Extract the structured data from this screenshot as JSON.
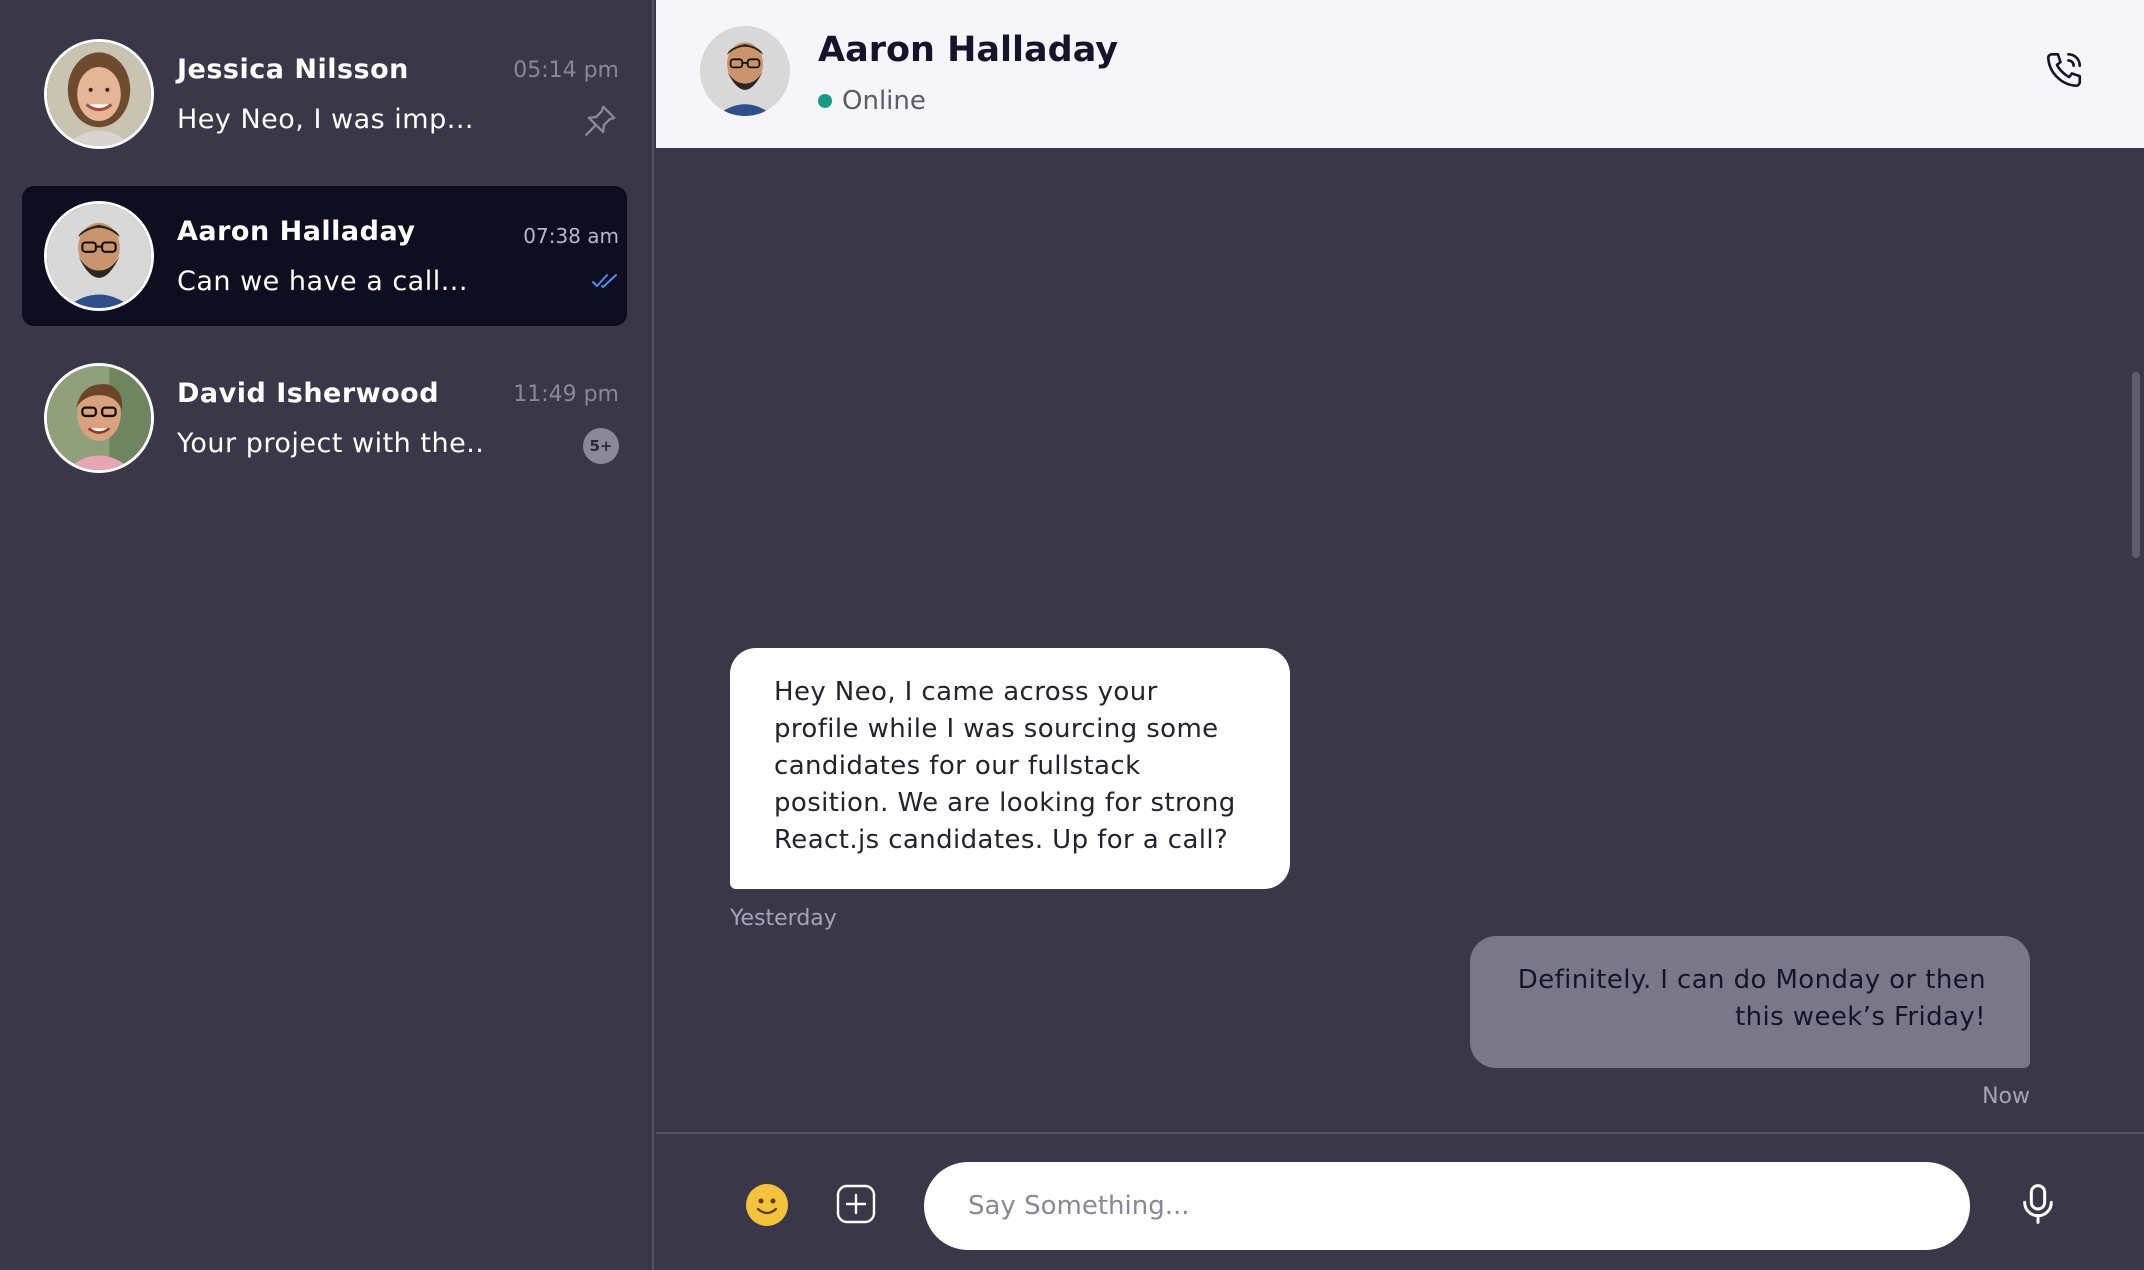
{
  "conversations": [
    {
      "name": "Jessica Nilsson",
      "time": "05:14 pm",
      "preview": "Hey Neo, I was imp...",
      "status_icon": "pin-icon"
    },
    {
      "name": "Aaron Halladay",
      "time": "07:38 am",
      "preview": "Can we have a call...",
      "status_icon": "double-check-icon",
      "active": true
    },
    {
      "name": "David Isherwood",
      "time": "11:49 pm",
      "preview": "Your project with the..",
      "unread_badge": "5+"
    }
  ],
  "chat": {
    "contact_name": "Aaron Halladay",
    "status": "Online",
    "status_color": "#1a9a86",
    "call_icon": "phone-icon",
    "messages": [
      {
        "direction": "incoming",
        "text": "Hey Neo, I came across your profile while I was sourcing some candidates for our fullstack position. We are looking for strong React.js candidates. Up for a call?",
        "timestamp": "Yesterday"
      },
      {
        "direction": "outgoing",
        "text": "Definitely. I can do Monday or then this week’s Friday!",
        "timestamp": "Now"
      }
    ],
    "composer": {
      "placeholder": "Say Something...",
      "value": "",
      "emoji_icon": "emoji-icon",
      "add_icon": "add-attachment-icon",
      "mic_icon": "microphone-icon"
    }
  },
  "colors": {
    "sidebar_bg": "#3a3749",
    "active_item_bg": "#0f0d20",
    "header_bg": "#f6f6fa",
    "incoming_bubble": "#ffffff",
    "outgoing_bubble": "#7a7789",
    "read_check": "#4a8ff0"
  }
}
